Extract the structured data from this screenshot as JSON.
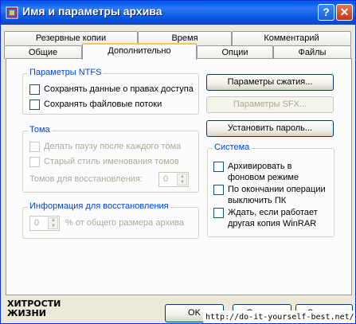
{
  "window": {
    "title": "Имя и параметры архива",
    "help_label": "?",
    "close_label": "✕"
  },
  "tabs_back": [
    "Резервные копии",
    "Время",
    "Комментарий"
  ],
  "tabs_front": [
    "Общие",
    "Дополнительно",
    "Опции",
    "Файлы"
  ],
  "ntfs": {
    "legend": "Параметры NTFS",
    "items": [
      "Сохранять данные о правах доступа",
      "Сохранять файловые потоки"
    ]
  },
  "volumes": {
    "legend": "Тома",
    "items": [
      "Делать паузу после каждого тома",
      "Старый стиль именования томов"
    ],
    "recovery_label": "Томов для восстановления:",
    "recovery_value": "0"
  },
  "recovery": {
    "legend": "Информация для восстановления",
    "value": "0",
    "suffix": "% от общего размера архива"
  },
  "buttons": {
    "compression": "Параметры сжатия...",
    "sfx": "Параметры SFX...",
    "password": "Установить пароль..."
  },
  "system": {
    "legend": "Система",
    "items": [
      "Архивировать в фоновом режиме",
      "По окончании операции выключить ПК",
      "Ждать, если работает другая копия WinRAR"
    ]
  },
  "footer": {
    "ok": "OK",
    "cancel": "Отмена",
    "help": "Справка"
  },
  "logo": {
    "line1": "ХИТРОСТИ",
    "line2": "ЖИЗНИ"
  },
  "watermark": "http://do-it-yourself-best.net/"
}
